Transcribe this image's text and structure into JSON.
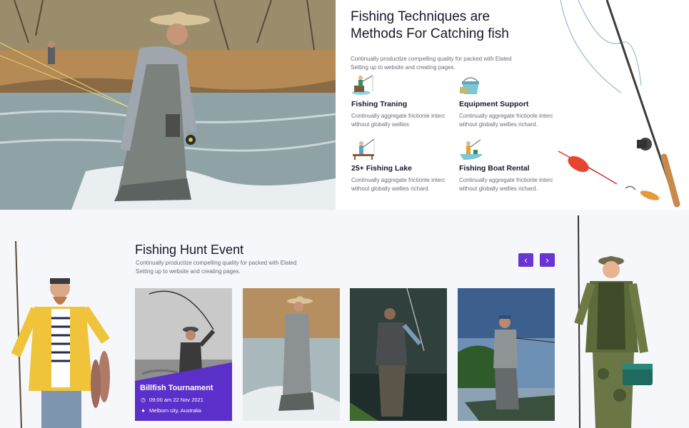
{
  "techniques": {
    "title": "Fishing Techniques are Methods For Catching fish",
    "description": "Continually productize compelling quality for packed with  Elated Setting up to website and creating pages.",
    "features": [
      {
        "title": "Fishing Traning",
        "description": "Continually aggregate frictionle interc without globally wellies",
        "icon": "fisherman-sitting-icon"
      },
      {
        "title": "Equipment Support",
        "description": "Continually aggregate frictionle interc without globally wellies richard.",
        "icon": "bucket-icon"
      },
      {
        "title": "25+ Fishing Lake",
        "description": "Continually aggregate frictionle interc without globally wellies richard.",
        "icon": "fishing-dock-icon"
      },
      {
        "title": "Fishing Boat Rental",
        "description": "Continually aggregate frictionle interc without globally wellies richard.",
        "icon": "fishing-boat-icon"
      }
    ]
  },
  "event": {
    "title": "Fishing Hunt Event",
    "description": "Continually productize compelling quality for packed with  Elated Setting up to website and creating pages.",
    "prev_label": "‹",
    "next_label": "›",
    "featured": {
      "title": "Billfish Tournament",
      "time": "09:00 am 22 Nov 2021",
      "location": "Melborn city, Australia"
    }
  },
  "colors": {
    "accent": "#6a33d4",
    "overlay": "#5b2fc9"
  }
}
